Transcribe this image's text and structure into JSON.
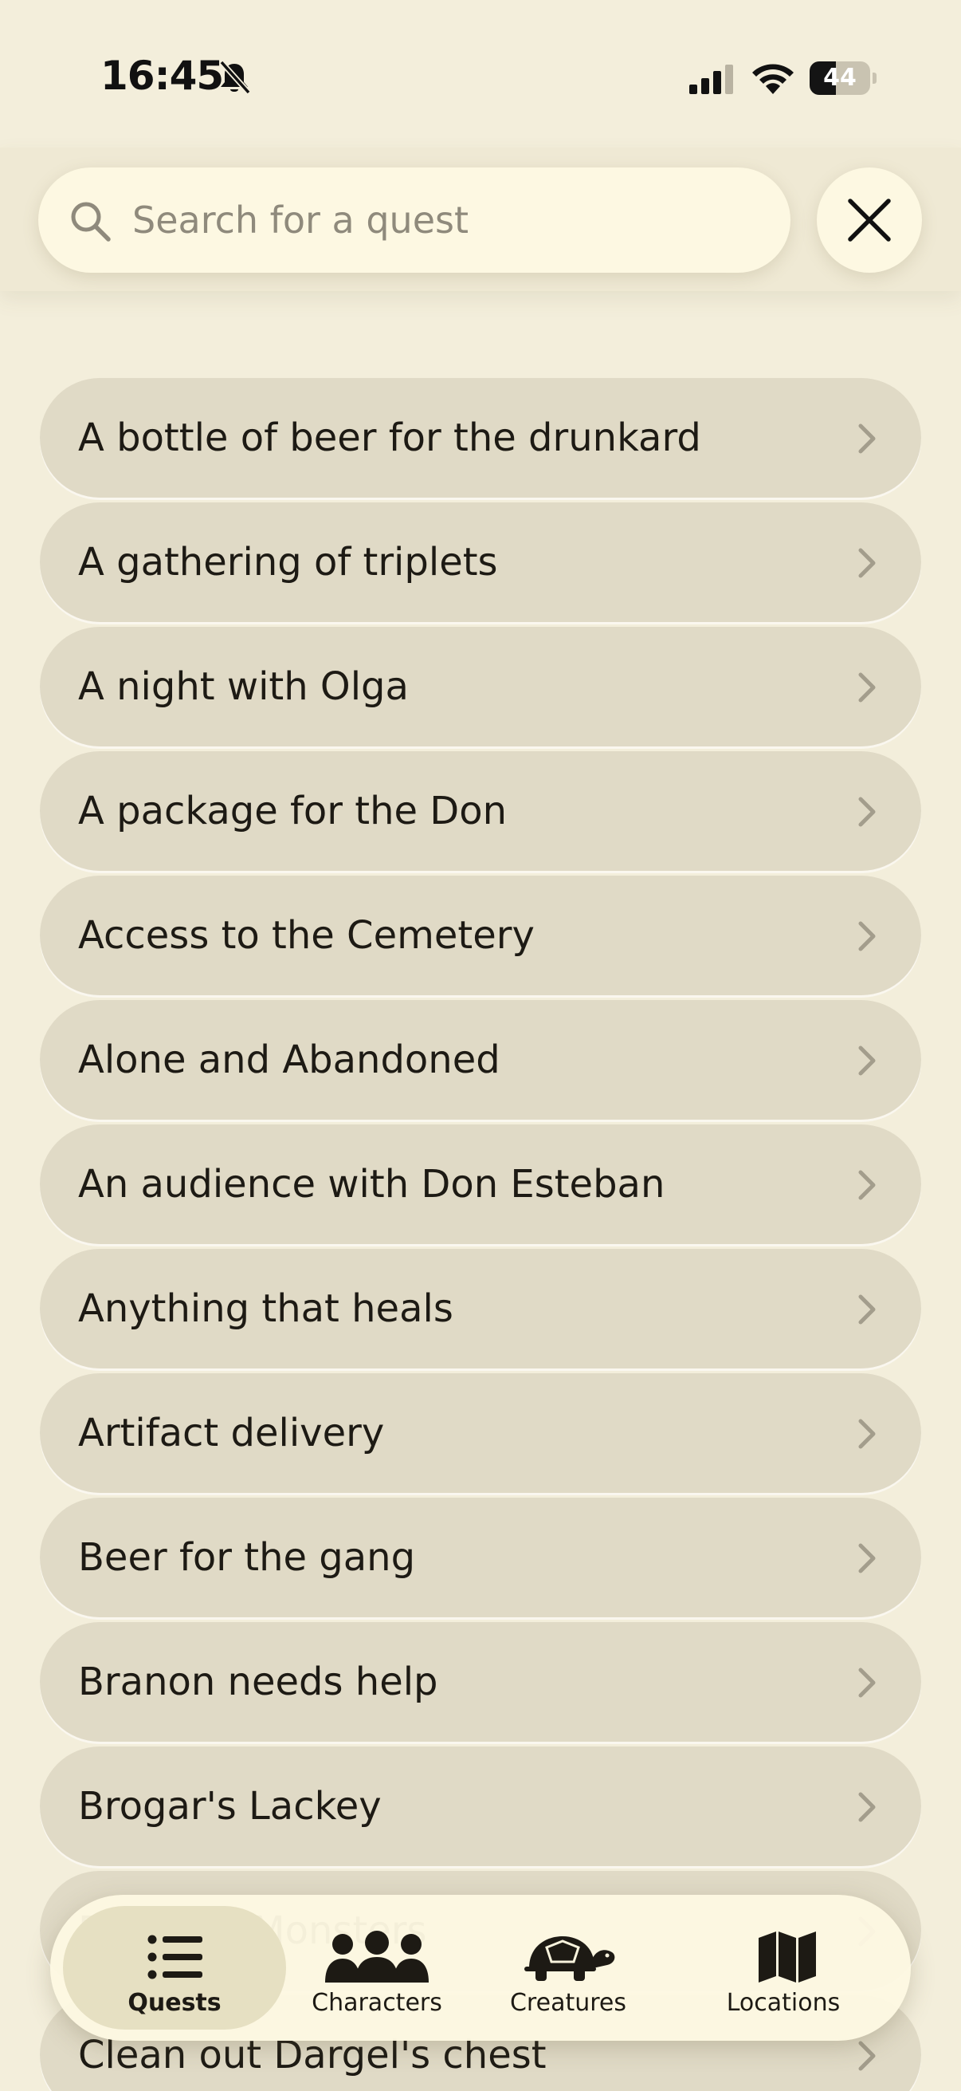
{
  "status_bar": {
    "time": "16:45",
    "battery_level": "44"
  },
  "search": {
    "placeholder": "Search for a quest"
  },
  "quests": [
    "A bottle of beer for the drunkard",
    "A gathering of triplets",
    "A night with Olga",
    "A package for the Don",
    "Access to the Cemetery",
    "Alone and Abandoned",
    "An audience with Don Esteban",
    "Anything that heals",
    "Artifact delivery",
    "Beer for the gang",
    "Branon needs help",
    "Brogar's Lackey",
    "Bugbear Monsters",
    "Clean out Dargel's chest"
  ],
  "tabs": [
    {
      "label": "Quests",
      "icon": "list-icon",
      "active": true
    },
    {
      "label": "Characters",
      "icon": "people-icon",
      "active": false
    },
    {
      "label": "Creatures",
      "icon": "turtle-icon",
      "active": false
    },
    {
      "label": "Locations",
      "icon": "map-icon",
      "active": false
    }
  ],
  "colors": {
    "background": "#f3eedb",
    "card": "#e0dac6",
    "search_field": "#fdf8e2",
    "active_tab": "#e6e0c2",
    "text": "#1d1a14"
  }
}
